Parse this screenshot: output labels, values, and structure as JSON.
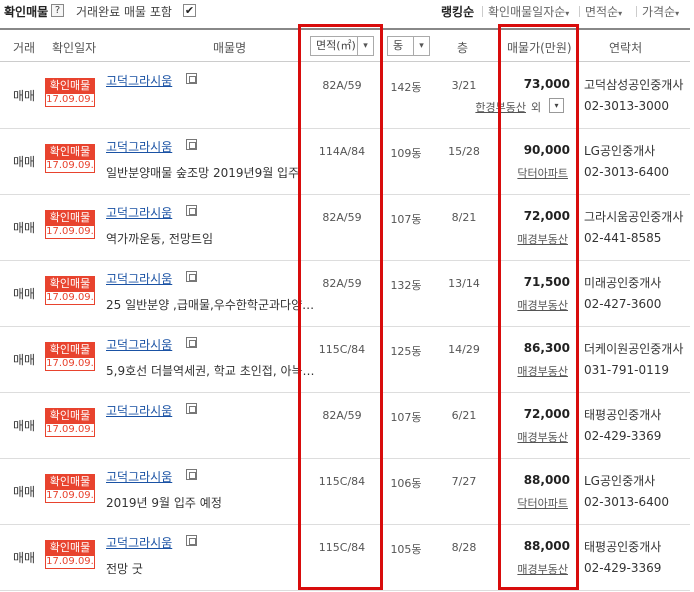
{
  "toolbar": {
    "verified_label": "확인매물",
    "help": "?",
    "include_completed": "거래완료 매물 포함",
    "checkmark": "✔",
    "sorts": [
      {
        "label": "랭킹순",
        "active": true
      },
      {
        "label": "확인매물일자순",
        "caret": "▾"
      },
      {
        "label": "면적순",
        "caret": "▾"
      },
      {
        "label": "가격순",
        "caret": "▾"
      }
    ]
  },
  "header": {
    "type": "거래",
    "date": "확인일자",
    "name": "매물명",
    "area_select": "면적(㎡)",
    "dong_select": "동",
    "floor": "층",
    "price": "매물가(만원)",
    "contact": "연락처",
    "arrow": "▾"
  },
  "badge": {
    "top": "확인매물",
    "date": "17.09.09."
  },
  "more_label": "외",
  "more_btn": "▾",
  "rows": [
    {
      "type": "매매",
      "name": "고덕그라시움",
      "desc": "",
      "area": "82A/59",
      "dong": "142동",
      "floor": "3/21",
      "price": "73,000",
      "agent": "한경부동산",
      "has_more": true,
      "office": "고덕삼성공인중개사",
      "phone": "02-3013-3000"
    },
    {
      "type": "매매",
      "name": "고덕그라시움",
      "desc": "일반분양매물 숲조망 2019년9월 입주",
      "area": "114A/84",
      "dong": "109동",
      "floor": "15/28",
      "price": "90,000",
      "agent": "닥터아파트",
      "office": "LG공인중개사",
      "phone": "02-3013-6400"
    },
    {
      "type": "매매",
      "name": "고덕그라시움",
      "desc": "역가까운동, 전망트임",
      "area": "82A/59",
      "dong": "107동",
      "floor": "8/21",
      "price": "72,000",
      "agent": "매경부동산",
      "office": "그라시움공인중개사",
      "phone": "02-441-8585"
    },
    {
      "type": "매매",
      "name": "고덕그라시움",
      "desc": "25 일반분양 ,급매물,우수한학군과다양…",
      "area": "82A/59",
      "dong": "132동",
      "floor": "13/14",
      "price": "71,500",
      "agent": "매경부동산",
      "office": "미래공인중개사",
      "phone": "02-427-3600"
    },
    {
      "type": "매매",
      "name": "고덕그라시움",
      "desc": "5,9호선 더블역세권, 학교 초인접, 아늑…",
      "area": "115C/84",
      "dong": "125동",
      "floor": "14/29",
      "price": "86,300",
      "agent": "매경부동산",
      "office": "더케이원공인중개사",
      "phone": "031-791-0119"
    },
    {
      "type": "매매",
      "name": "고덕그라시움",
      "desc": "",
      "area": "82A/59",
      "dong": "107동",
      "floor": "6/21",
      "price": "72,000",
      "agent": "매경부동산",
      "office": "태평공인중개사",
      "phone": "02-429-3369"
    },
    {
      "type": "매매",
      "name": "고덕그라시움",
      "desc": "2019년 9월 입주 예정",
      "area": "115C/84",
      "dong": "106동",
      "floor": "7/27",
      "price": "88,000",
      "agent": "닥터아파트",
      "office": "LG공인중개사",
      "phone": "02-3013-6400"
    },
    {
      "type": "매매",
      "name": "고덕그라시움",
      "desc": "전망 굿",
      "area": "115C/84",
      "dong": "105동",
      "floor": "8/28",
      "price": "88,000",
      "agent": "매경부동산",
      "office": "태평공인중개사",
      "phone": "02-429-3369"
    }
  ],
  "colors": {
    "highlight": "#d80c0c",
    "badge": "#e8432e",
    "link": "#1a52a4"
  }
}
